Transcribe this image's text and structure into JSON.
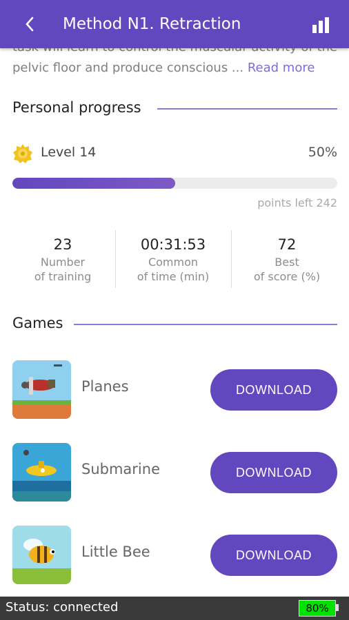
{
  "header": {
    "title": "Method N1. Retraction"
  },
  "intro": {
    "line1": "task will learn to control the muscular activity of the",
    "line2": "pelvic floor and produce conscious ...",
    "read_more": "Read more"
  },
  "progress": {
    "section_title": "Personal progress",
    "level_label": "Level 14",
    "percent_label": "50%",
    "fraction": 0.5,
    "points_left": "points left 242",
    "stats": [
      {
        "value": "23",
        "label_line1": "Number",
        "label_line2": "of training"
      },
      {
        "value": "00:31:53",
        "label_line1": "Common",
        "label_line2": "of time (min)"
      },
      {
        "value": "72",
        "label_line1": "Best",
        "label_line2": "of score (%)"
      }
    ]
  },
  "games": {
    "section_title": "Games",
    "items": [
      {
        "name": "Planes",
        "button": "DOWNLOAD"
      },
      {
        "name": "Submarine",
        "button": "DOWNLOAD"
      },
      {
        "name": "Little Bee",
        "button": "DOWNLOAD"
      }
    ]
  },
  "status": {
    "text": "Status: connected",
    "battery": "80%"
  },
  "colors": {
    "accent": "#6347be",
    "battery": "#00e100"
  }
}
